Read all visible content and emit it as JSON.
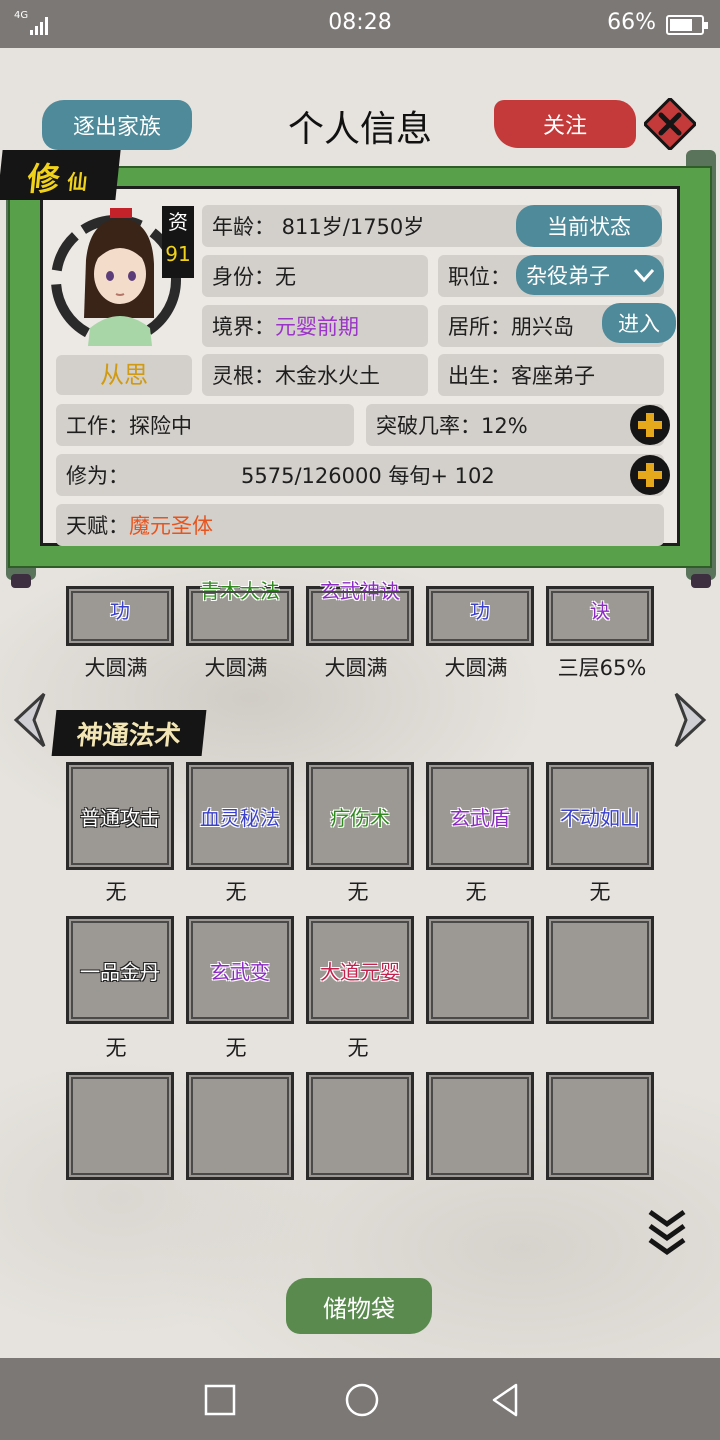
{
  "status_bar": {
    "network": "4G",
    "time": "08:28",
    "battery": "66%"
  },
  "header": {
    "expel_label": "逐出家族",
    "title": "个人信息",
    "follow_label": "关注"
  },
  "profile": {
    "tag_big": "修",
    "tag_small": "仙",
    "aptitude_label": "资",
    "aptitude_value": "91",
    "name": "从思",
    "age": "年龄：    811岁/1750岁",
    "status_btn": "当前状态",
    "identity": "身份：无",
    "position_label": "职位：",
    "position_value": "杂役弟子",
    "realm_label": "境界：",
    "realm_value": "元婴前期",
    "residence": "居所：朋兴岛",
    "enter_btn": "进入",
    "root": "灵根：木金水火土",
    "birth": "出生：客座弟子",
    "job": "工作：探险中",
    "breakthrough": "突破几率：12%",
    "cultivation_label": "修为：",
    "cultivation_value": "5575/126000  每旬+ 102",
    "talent_label": "天赋：",
    "talent_value": "魔元圣体"
  },
  "techniques_partial": [
    {
      "label": "功",
      "level": "大圆满"
    },
    {
      "label": "青木大法",
      "level": "大圆满"
    },
    {
      "label": "玄武神诀",
      "level": "大圆满"
    },
    {
      "label": "功",
      "level": "大圆满"
    },
    {
      "label": "诀",
      "level": "三层65%"
    }
  ],
  "spells_section": {
    "title": "神通法术",
    "row1": [
      {
        "label": "普通攻击",
        "level": "无"
      },
      {
        "label": "血灵秘法",
        "level": "无"
      },
      {
        "label": "疗伤术",
        "level": "无"
      },
      {
        "label": "玄武盾",
        "level": "无"
      },
      {
        "label": "不动如山",
        "level": "无"
      }
    ],
    "row2": [
      {
        "label": "一品金丹",
        "level": "无"
      },
      {
        "label": "玄武变",
        "level": "无"
      },
      {
        "label": "大道元婴",
        "level": "无"
      }
    ]
  },
  "storage_label": "储物袋",
  "colors": {
    "teal_button": "#4e8a9a",
    "red_button": "#c43a3a",
    "scroll_green": "#58a04a",
    "realm_purple": "#9b34c8",
    "talent_orange": "#e8541e",
    "gold": "#f1d21a"
  },
  "icons": [
    "close-icon",
    "plus-icon",
    "chevron-down-icon",
    "arrow-left-icon",
    "arrow-right-icon",
    "double-chevron-down-icon",
    "nav-recents-icon",
    "nav-home-icon",
    "nav-back-icon"
  ]
}
